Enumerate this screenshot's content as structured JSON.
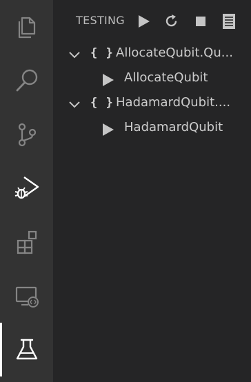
{
  "panel": {
    "title": "TESTING",
    "actions": [
      {
        "icon": "play-icon",
        "tooltip": "Run All Tests"
      },
      {
        "icon": "refresh-icon",
        "tooltip": "Refresh"
      },
      {
        "icon": "stop-icon",
        "tooltip": "Cancel"
      },
      {
        "icon": "output-log-icon",
        "tooltip": "Show Test Log"
      }
    ]
  },
  "activitybar": {
    "items": [
      {
        "icon": "files-icon",
        "active": false
      },
      {
        "icon": "search-icon",
        "active": false
      },
      {
        "icon": "source-control-icon",
        "active": false
      },
      {
        "icon": "run-debug-icon",
        "active": false
      },
      {
        "icon": "extensions-icon",
        "active": false
      },
      {
        "icon": "remote-explorer-icon",
        "active": false
      },
      {
        "icon": "testing-flask-icon",
        "active": true
      }
    ]
  },
  "tests": {
    "suites": [
      {
        "label": "AllocateQubit.Qu...",
        "expanded": true,
        "tests": [
          {
            "label": "AllocateQubit"
          }
        ]
      },
      {
        "label": "HadamardQubit....",
        "expanded": true,
        "tests": [
          {
            "label": "HadamardQubit"
          }
        ]
      }
    ]
  },
  "colors": {
    "activitybar_bg": "#333333",
    "panel_bg": "#252526",
    "icon_inactive": "#858585",
    "icon_active": "#ffffff",
    "text": "#cccccc"
  }
}
